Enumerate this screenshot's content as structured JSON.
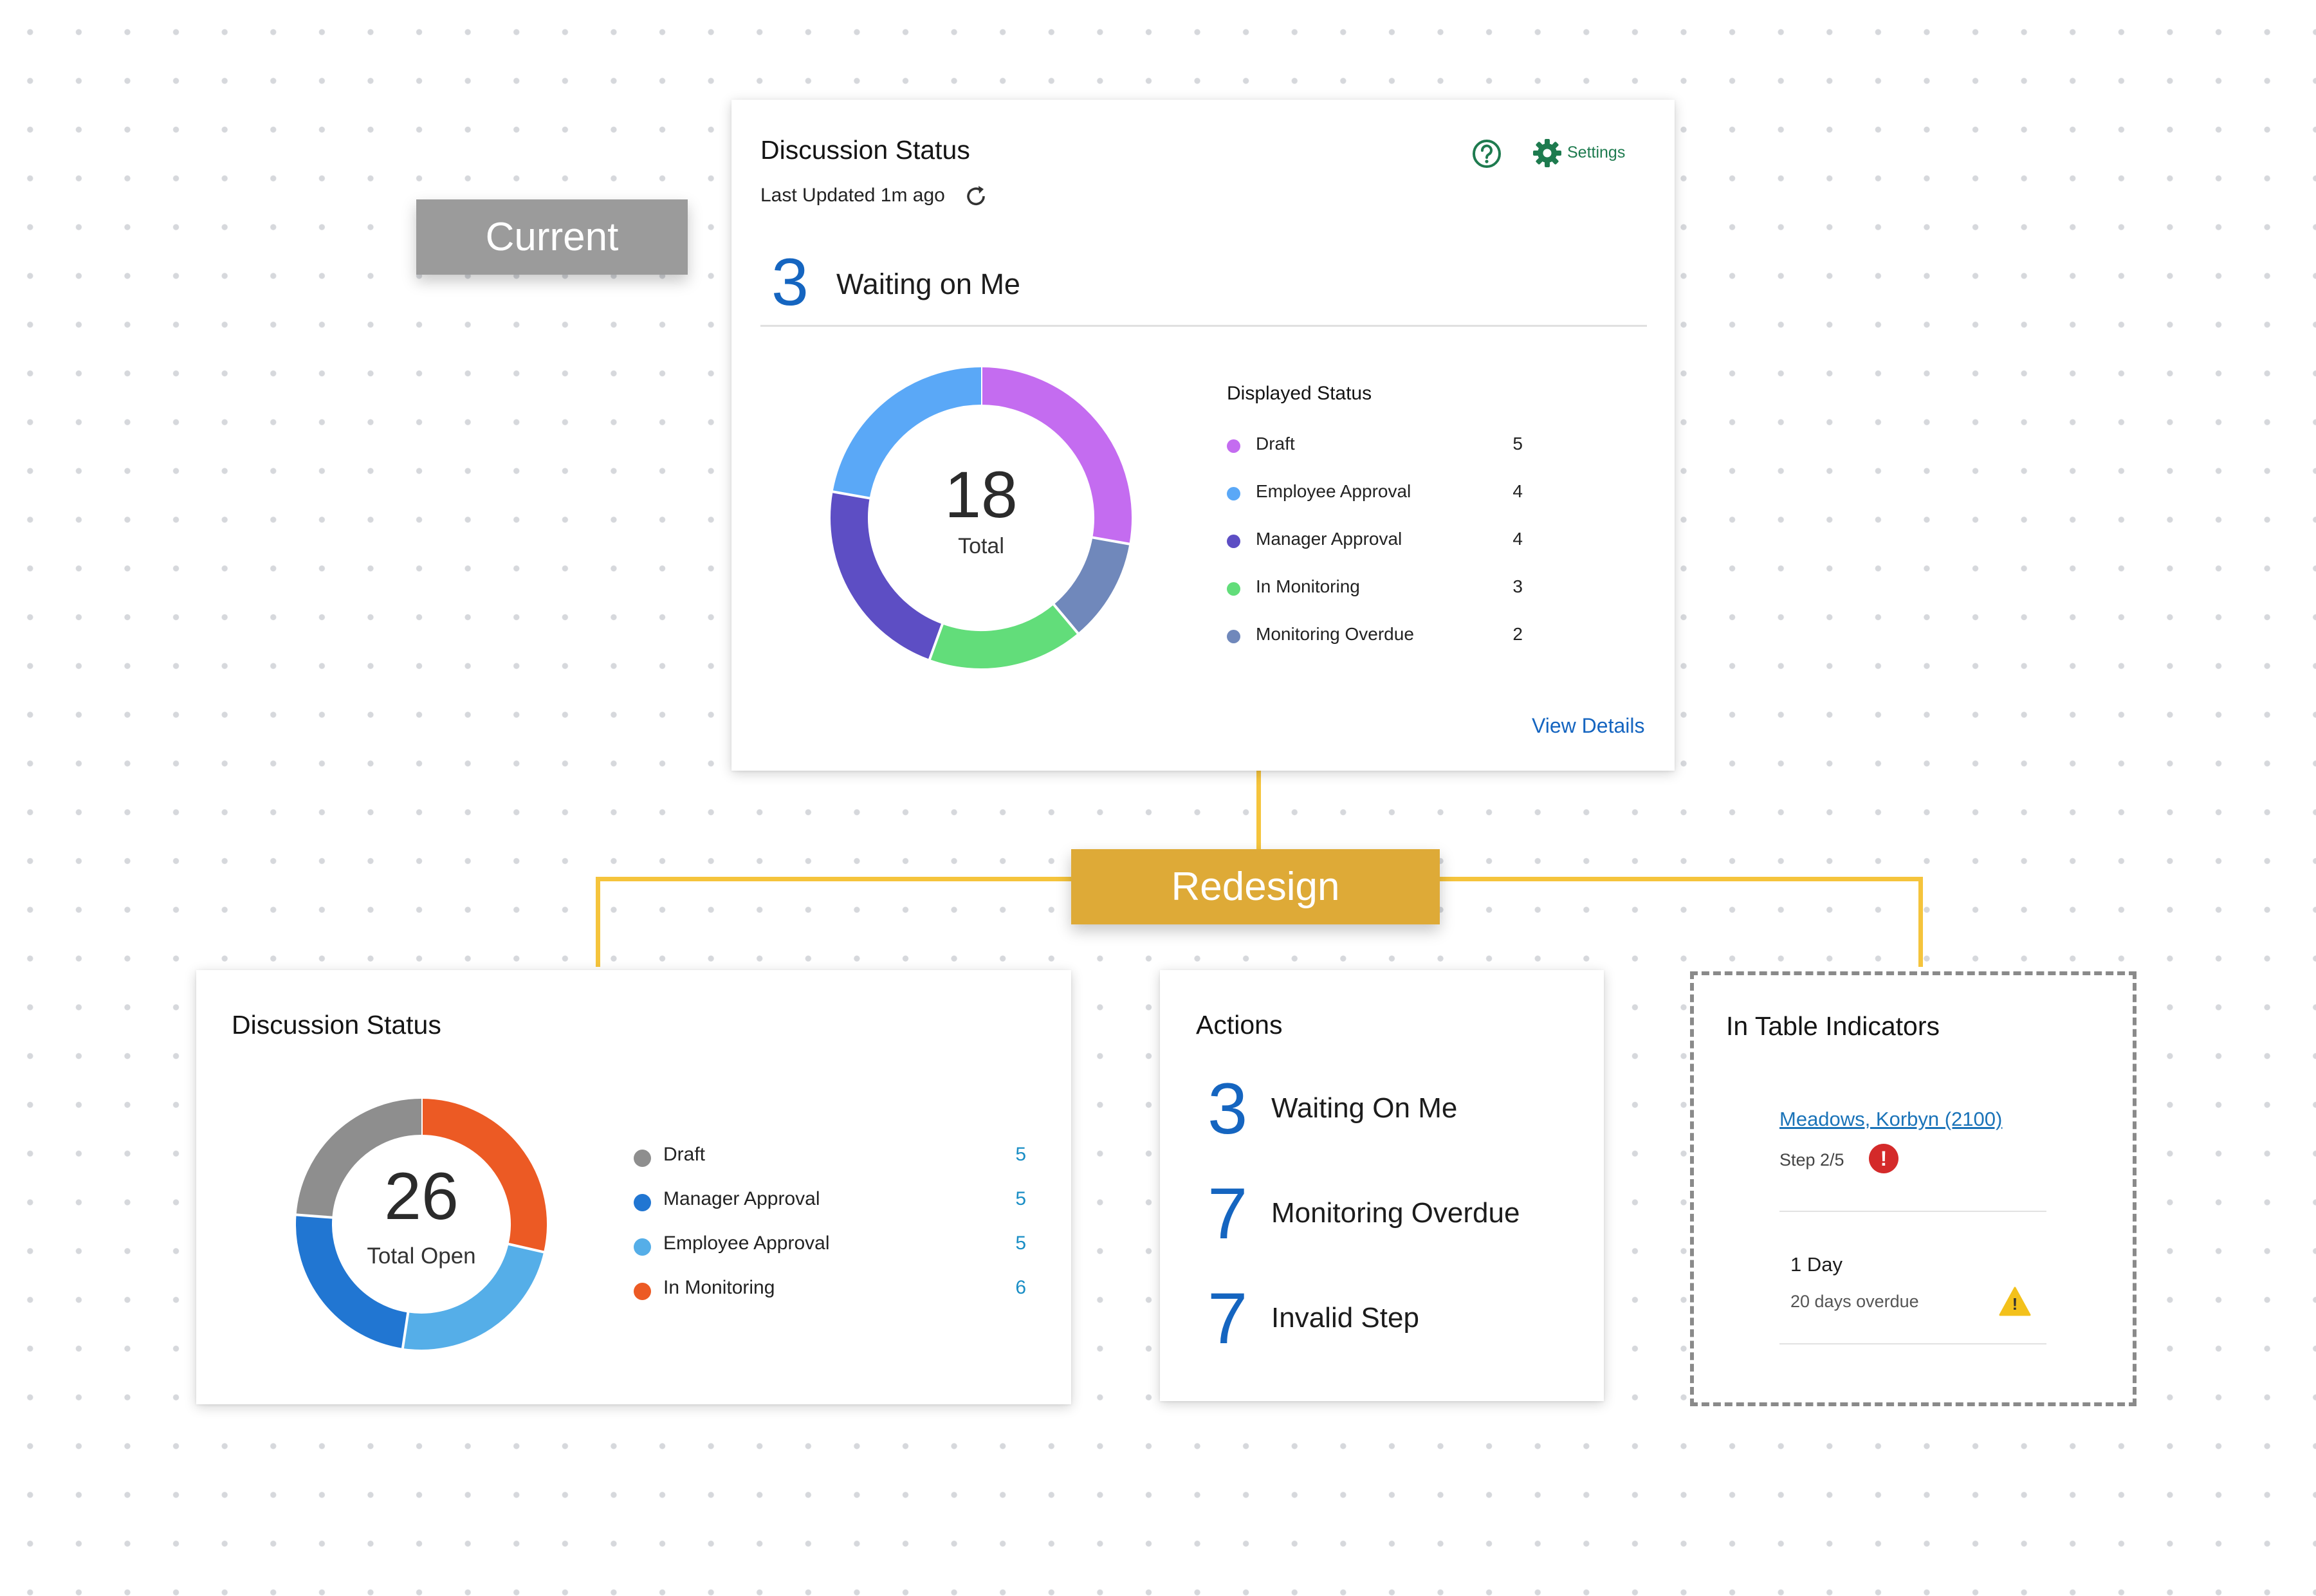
{
  "tags": {
    "current": "Current",
    "redesign": "Redesign"
  },
  "current_card": {
    "title": "Discussion Status",
    "help_icon": "help-circle-icon",
    "settings_icon": "gear-icon",
    "settings_label": "Settings",
    "last_updated": "Last Updated 1m ago",
    "refresh_icon": "refresh-icon",
    "waiting_count": "3",
    "waiting_label": "Waiting on Me",
    "donut_total": "18",
    "donut_caption": "Total",
    "legend_title": "Displayed Status",
    "legend": [
      {
        "label": "Draft",
        "value": "5",
        "color": "#c46cf0"
      },
      {
        "label": "Employee Approval",
        "value": "4",
        "color": "#5aa8f7"
      },
      {
        "label": "Manager Approval",
        "value": "4",
        "color": "#5d4ec4"
      },
      {
        "label": "In Monitoring",
        "value": "3",
        "color": "#62dd7a"
      },
      {
        "label": "Monitoring Overdue",
        "value": "2",
        "color": "#7088bb"
      }
    ],
    "view_details": "View Details"
  },
  "redesign_status_card": {
    "title": "Discussion Status",
    "donut_total": "26",
    "donut_caption": "Total Open",
    "legend": [
      {
        "label": "Draft",
        "value": "5",
        "color": "#8e8e8e"
      },
      {
        "label": "Manager Approval",
        "value": "5",
        "color": "#2176d2"
      },
      {
        "label": "Employee Approval",
        "value": "5",
        "color": "#55aee8"
      },
      {
        "label": "In Monitoring",
        "value": "6",
        "color": "#ec5a24"
      }
    ]
  },
  "actions_card": {
    "title": "Actions",
    "items": [
      {
        "count": "3",
        "label": "Waiting On Me"
      },
      {
        "count": "7",
        "label": "Monitoring Overdue"
      },
      {
        "count": "7",
        "label": "Invalid Step"
      }
    ]
  },
  "indicators_card": {
    "title": "In Table Indicators",
    "employee_link": "Meadows, Korbyn (2100)",
    "step_text": "Step 2/5",
    "error_icon": "error-circle-icon",
    "error_glyph": "!",
    "duration": "1 Day",
    "overdue_text": "20 days overdue",
    "warning_icon": "warning-triangle-icon",
    "warning_glyph": "!"
  },
  "colors": {
    "accent_blue": "#1565c0",
    "settings_green": "#1e7b4f",
    "connector_yellow": "#f5c43c",
    "redesign_tag": "#deaa37",
    "current_tag": "#9b9b9b",
    "error_red": "#d42a2a",
    "warning_yellow": "#f3c11b"
  }
}
